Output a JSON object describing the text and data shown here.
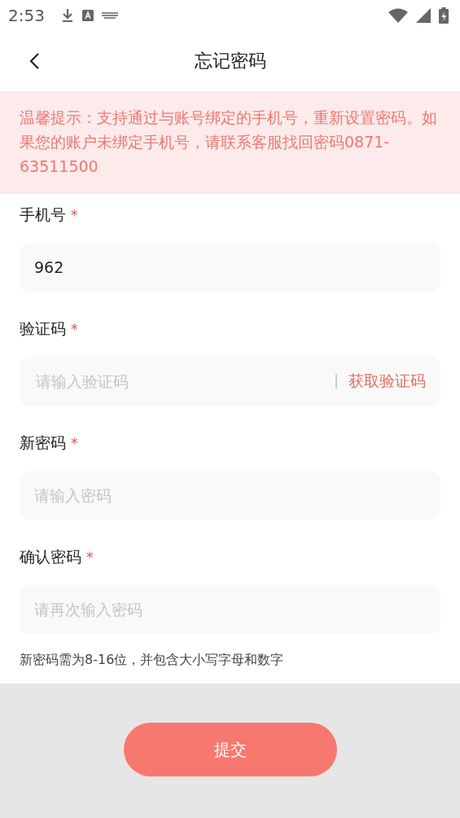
{
  "status_bar": {
    "time": "2:53"
  },
  "header": {
    "title": "忘记密码"
  },
  "notice": {
    "text": "温馨提示：支持通过与账号绑定的手机号，重新设置密码。如果您的账户未绑定手机号，请联系客服找回密码0871-63511500"
  },
  "fields": [
    {
      "label": "手机号",
      "required_mark": "*",
      "value": "962",
      "kind": "text"
    },
    {
      "label": "验证码",
      "required_mark": "*",
      "placeholder": "请输入验证码",
      "kind": "code",
      "action": "获取验证码"
    },
    {
      "label": "新密码",
      "required_mark": "*",
      "placeholder": "请输入密码",
      "kind": "text"
    },
    {
      "label": "确认密码",
      "required_mark": "*",
      "placeholder": "请再次输入密码",
      "kind": "text"
    }
  ],
  "hint": "新密码需为8-16位，并包含大小写字母和数字",
  "submit": {
    "label": "提交"
  }
}
